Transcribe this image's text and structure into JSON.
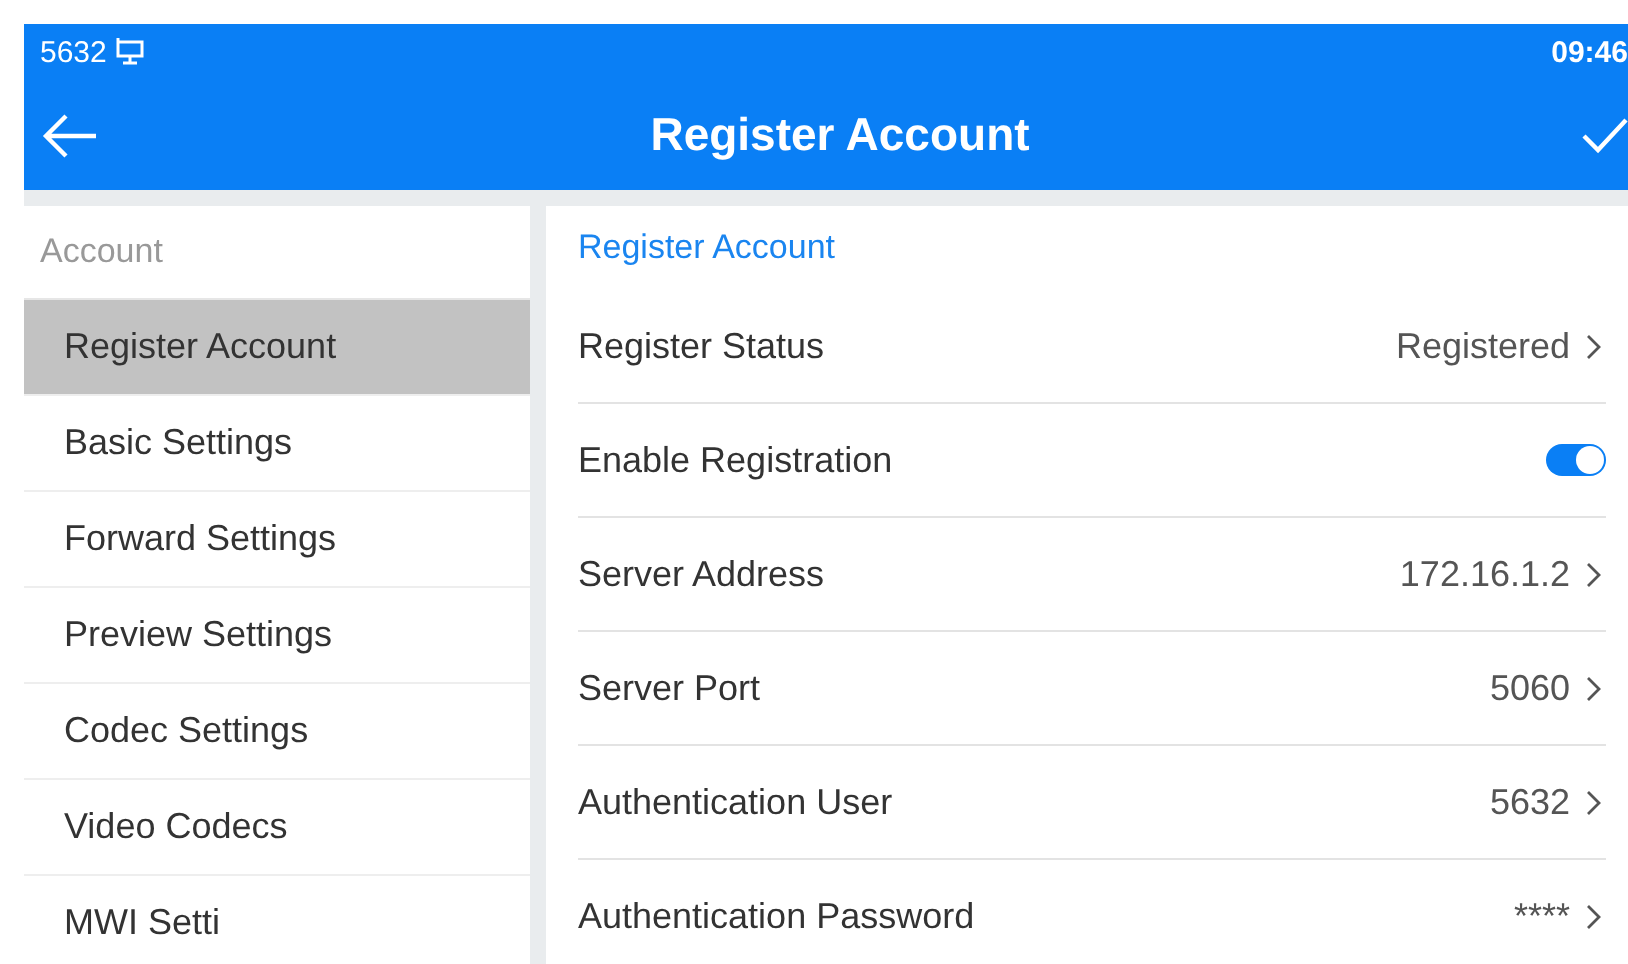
{
  "status_bar": {
    "account": "5632",
    "time": "09:46"
  },
  "title_bar": {
    "title": "Register Account"
  },
  "sidebar": {
    "header": "Account",
    "items": [
      {
        "label": "Register Account",
        "selected": true
      },
      {
        "label": "Basic Settings",
        "selected": false
      },
      {
        "label": "Forward Settings",
        "selected": false
      },
      {
        "label": "Preview Settings",
        "selected": false
      },
      {
        "label": "Codec Settings",
        "selected": false
      },
      {
        "label": "Video Codecs",
        "selected": false
      },
      {
        "label": "MWI Setti",
        "selected": false
      }
    ]
  },
  "panel": {
    "header": "Register Account",
    "rows": [
      {
        "kind": "value",
        "label": "Register Status",
        "value": "Registered"
      },
      {
        "kind": "toggle",
        "label": "Enable Registration",
        "on": true
      },
      {
        "kind": "value",
        "label": "Server Address",
        "value": "172.16.1.2"
      },
      {
        "kind": "value",
        "label": "Server Port",
        "value": "5060"
      },
      {
        "kind": "value",
        "label": "Authentication User",
        "value": "5632"
      },
      {
        "kind": "value",
        "label": "Authentication Password",
        "value": "****"
      }
    ]
  }
}
